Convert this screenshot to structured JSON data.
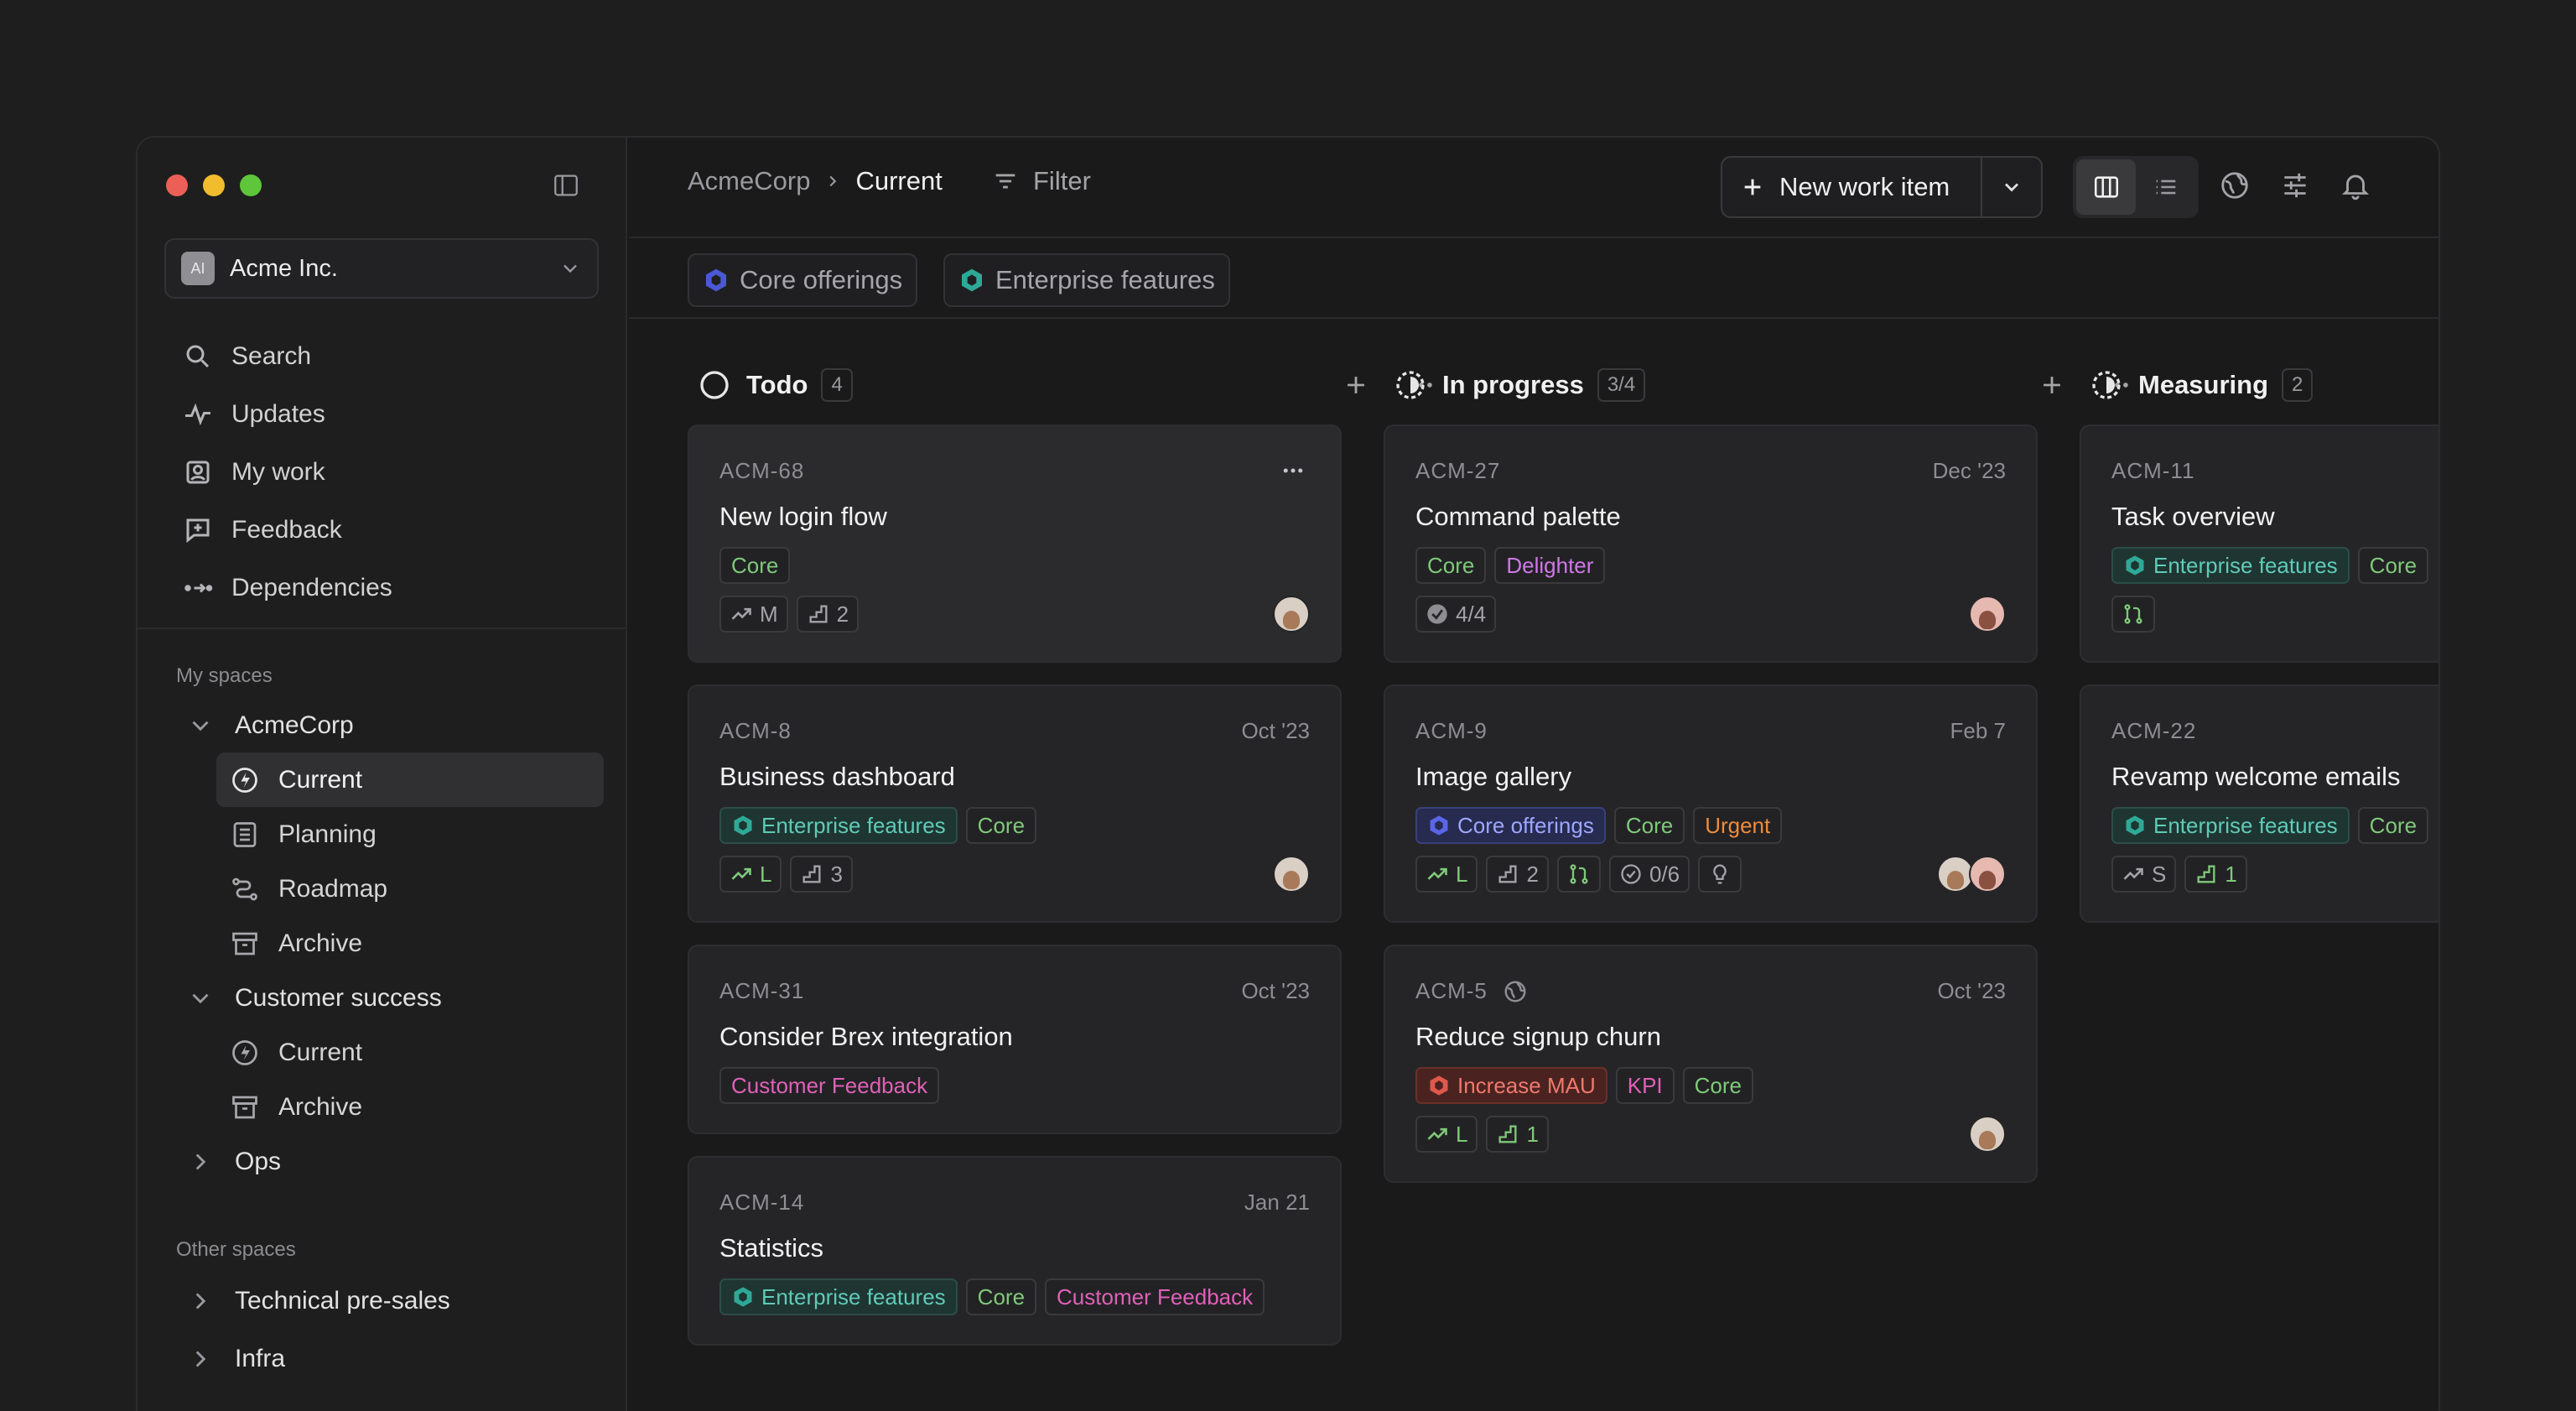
{
  "workspace": {
    "avatar_text": "AI",
    "name": "Acme Inc."
  },
  "nav": [
    {
      "label": "Search",
      "icon": "search-icon"
    },
    {
      "label": "Updates",
      "icon": "pulse-icon"
    },
    {
      "label": "My work",
      "icon": "user-square-icon"
    },
    {
      "label": "Feedback",
      "icon": "feedback-icon"
    },
    {
      "label": "Dependencies",
      "icon": "dependencies-icon"
    }
  ],
  "sections": {
    "my_spaces": "My spaces",
    "other_spaces": "Other spaces"
  },
  "spaces": {
    "acmecorp": {
      "label": "AcmeCorp",
      "children": [
        "Current",
        "Planning",
        "Roadmap",
        "Archive"
      ]
    },
    "customer_success": {
      "label": "Customer success",
      "children": [
        "Current",
        "Archive"
      ]
    },
    "ops": {
      "label": "Ops"
    },
    "technical_presales": {
      "label": "Technical pre-sales"
    },
    "infra": {
      "label": "Infra"
    }
  },
  "header": {
    "breadcrumb": [
      "AcmeCorp",
      "Current"
    ],
    "filter_label": "Filter",
    "new_button_label": "New work item"
  },
  "projects": [
    "Core offerings",
    "Enterprise features"
  ],
  "columns": [
    {
      "title": "Todo",
      "count": "4"
    },
    {
      "title": "In progress",
      "count": "3/4"
    },
    {
      "title": "Measuring",
      "count": "2"
    }
  ],
  "cards": {
    "acm68": {
      "id": "ACM-68",
      "title": "New login flow",
      "tags": [
        "Core"
      ],
      "meta": [
        "M",
        "2"
      ]
    },
    "acm8": {
      "id": "ACM-8",
      "date": "Oct '23",
      "title": "Business dashboard",
      "tags": [
        "Enterprise features",
        "Core"
      ],
      "meta": [
        "L",
        "3"
      ]
    },
    "acm31": {
      "id": "ACM-31",
      "date": "Oct '23",
      "title": "Consider Brex integration",
      "tags": [
        "Customer Feedback"
      ]
    },
    "acm14": {
      "id": "ACM-14",
      "date": "Jan 21",
      "title": "Statistics",
      "tags": [
        "Enterprise features",
        "Core",
        "Customer Feedback"
      ]
    },
    "acm27": {
      "id": "ACM-27",
      "date": "Dec '23",
      "title": "Command palette",
      "tags": [
        "Core",
        "Delighter"
      ],
      "meta": [
        "4/4"
      ]
    },
    "acm9": {
      "id": "ACM-9",
      "date": "Feb 7",
      "title": "Image gallery",
      "tags": [
        "Core offerings",
        "Core",
        "Urgent"
      ],
      "meta": [
        "L",
        "2",
        "0/6"
      ]
    },
    "acm5": {
      "id": "ACM-5",
      "date": "Oct '23",
      "title": "Reduce signup churn",
      "tags": [
        "Increase MAU",
        "KPI",
        "Core"
      ],
      "meta": [
        "L",
        "1"
      ]
    },
    "acm11": {
      "id": "ACM-11",
      "title": "Task overview",
      "tags": [
        "Enterprise features",
        "Core"
      ]
    },
    "acm22": {
      "id": "ACM-22",
      "title": "Revamp welcome emails",
      "tags": [
        "Enterprise features",
        "Core"
      ],
      "meta": [
        "S",
        "1"
      ]
    }
  },
  "colors": {
    "accent_green": "#7fc97a",
    "enterprise_teal": "#5fcbb8",
    "core_offerings_blue": "#9ea6ff",
    "feedback_pink": "#e060b8",
    "urgent_orange": "#ee8c3a"
  }
}
